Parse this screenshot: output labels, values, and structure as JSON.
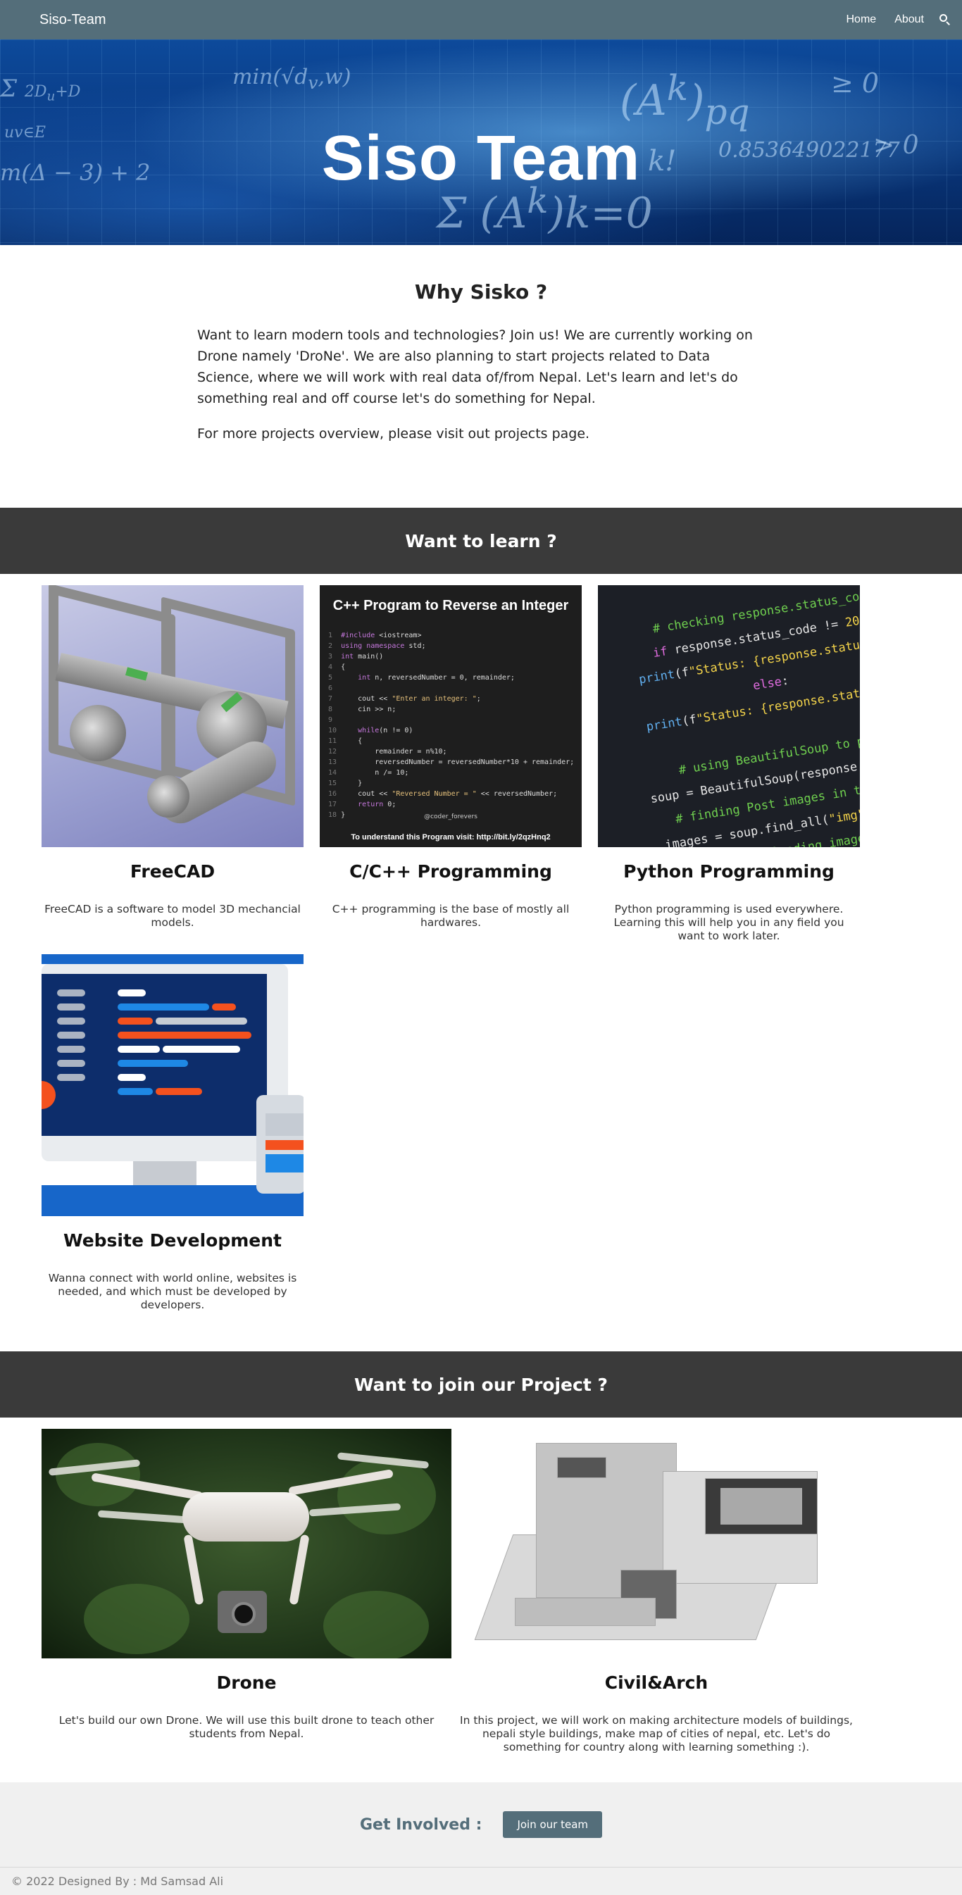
{
  "nav": {
    "brand": "Siso-Team",
    "links": [
      "Home",
      "About"
    ],
    "search_icon": "search-icon"
  },
  "hero": {
    "title": "Siso Team"
  },
  "why": {
    "heading": "Why Sisko ?",
    "paragraph1": "Want to learn modern tools and technologies? Join us! We are currently working on Drone namely 'DroNe'. We are also planning to start projects related to Data Science, where we will work with real data of/from Nepal. Let's learn and let's do something real and off course let's do something for Nepal.",
    "paragraph2": "For more projects overview, please visit out projects page."
  },
  "learn": {
    "heading": "Want to learn ?",
    "cards": [
      {
        "title": "FreeCAD",
        "description": "FreeCAD is a software to model 3D mechancial models."
      },
      {
        "title": "C/C++ Programming",
        "description": "C++ programming is the base of mostly all hardwares."
      },
      {
        "title": "Python Programming",
        "description": "Python programming is used everywhere. Learning this will help you in any field you want to work later."
      },
      {
        "title": "Website Development",
        "description": "Wanna connect with world online, websites is needed, and which must be developed by developers."
      }
    ],
    "cpp_image": {
      "title": "C++ Program to Reverse an Integer",
      "credit": "@coder_forevers",
      "footer": "To understand this Program visit: http://bit.ly/2qzHnq2"
    }
  },
  "join": {
    "heading": "Want to join our Project ?",
    "projects": [
      {
        "title": "Drone",
        "description": "Let's build our own Drone. We will use this built drone to teach other students from Nepal."
      },
      {
        "title": "Civil&Arch",
        "description": "In this project, we will work on making architecture models of buildings, nepali style buildings, make map of cities of nepal, etc. Let's do something for country along with learning something :)."
      }
    ]
  },
  "involved": {
    "label": "Get Involved :",
    "button": "Join our team"
  },
  "footer": {
    "text": "© 2022 Designed By : Md Samsad Ali"
  },
  "colors": {
    "navbar": "#546e7a",
    "band": "#3a3a3a",
    "involved_bg": "#f0f0f0"
  }
}
